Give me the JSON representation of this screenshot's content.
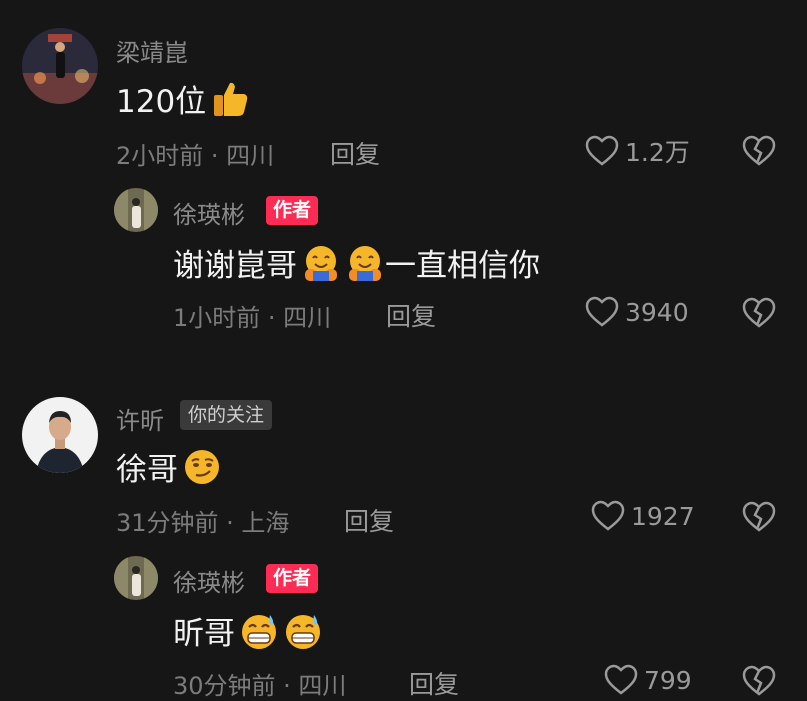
{
  "comments": [
    {
      "username": "梁靖崑",
      "text": "120位",
      "emoji": [
        "thumbs-up"
      ],
      "time": "2小时前 · 四川",
      "reply_label": "回复",
      "likes": "1.2万",
      "replies": [
        {
          "username": "徐瑛彬",
          "badge": "作者",
          "text": "谢谢崑哥",
          "text_after": "一直相信你",
          "emoji": [
            "hugging-face",
            "hugging-face"
          ],
          "time": "1小时前 · 四川",
          "reply_label": "回复",
          "likes": "3940"
        }
      ]
    },
    {
      "username": "许昕",
      "badge": "你的关注",
      "text": "徐哥",
      "emoji": [
        "smirking-face"
      ],
      "time": "31分钟前 · 上海",
      "reply_label": "回复",
      "likes": "1927",
      "replies": [
        {
          "username": "徐瑛彬",
          "badge": "作者",
          "text": "昕哥",
          "emoji": [
            "grinning-sweat-face",
            "grinning-sweat-face"
          ],
          "time": "30分钟前 · 四川",
          "reply_label": "回复",
          "likes": "799"
        }
      ]
    }
  ],
  "colors": {
    "background": "#161616",
    "author_badge": "#fe2c55",
    "follow_badge": "#3a3a3a",
    "emoji_yellow": "#f5b62a"
  }
}
